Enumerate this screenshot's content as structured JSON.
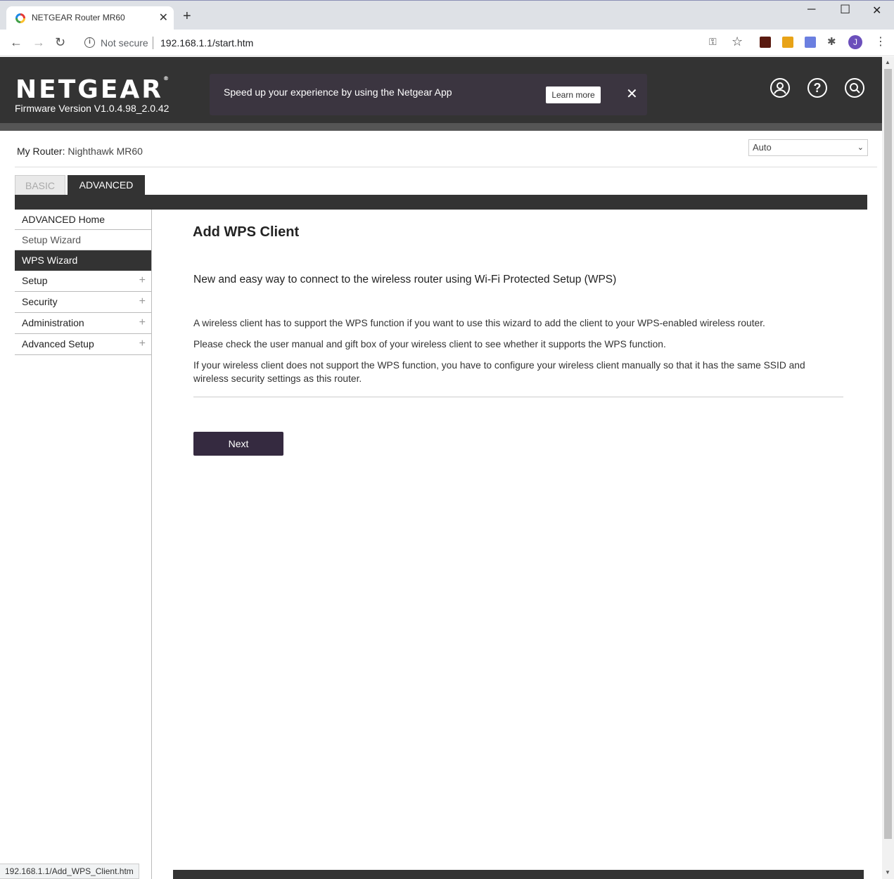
{
  "browser": {
    "tab_title": "NETGEAR Router MR60",
    "security_label": "Not secure",
    "url": "192.168.1.1/start.htm",
    "profile_initial": "J",
    "status_url": "192.168.1.1/Add_WPS_Client.htm"
  },
  "header": {
    "logo": "NETGEAR",
    "firmware": "Firmware Version V1.0.4.98_2.0.42",
    "banner_text": "Speed up your experience by using the Netgear App",
    "banner_button": "Learn more"
  },
  "router": {
    "label": "My Router:",
    "name": "Nighthawk MR60",
    "language_selected": "Auto"
  },
  "tabs": {
    "basic": "BASIC",
    "advanced": "ADVANCED"
  },
  "sidebar": {
    "items": [
      {
        "label": "ADVANCED Home"
      },
      {
        "label": "Setup Wizard"
      },
      {
        "label": "WPS Wizard"
      },
      {
        "label": "Setup"
      },
      {
        "label": "Security"
      },
      {
        "label": "Administration"
      },
      {
        "label": "Advanced Setup"
      }
    ]
  },
  "content": {
    "title": "Add WPS Client",
    "subtitle": "New and easy way to connect to the wireless router using Wi-Fi Protected Setup (WPS)",
    "p1": "A wireless client has to support the WPS function if you want to use this wizard to add the client to your WPS-enabled wireless router.",
    "p2": "Please check the user manual and gift box of your wireless client to see whether it supports the WPS function.",
    "p3": "If your wireless client does not support the WPS function, you have to configure your wireless client manually so that it has the same SSID and wireless security settings as this router.",
    "next_button": "Next"
  }
}
